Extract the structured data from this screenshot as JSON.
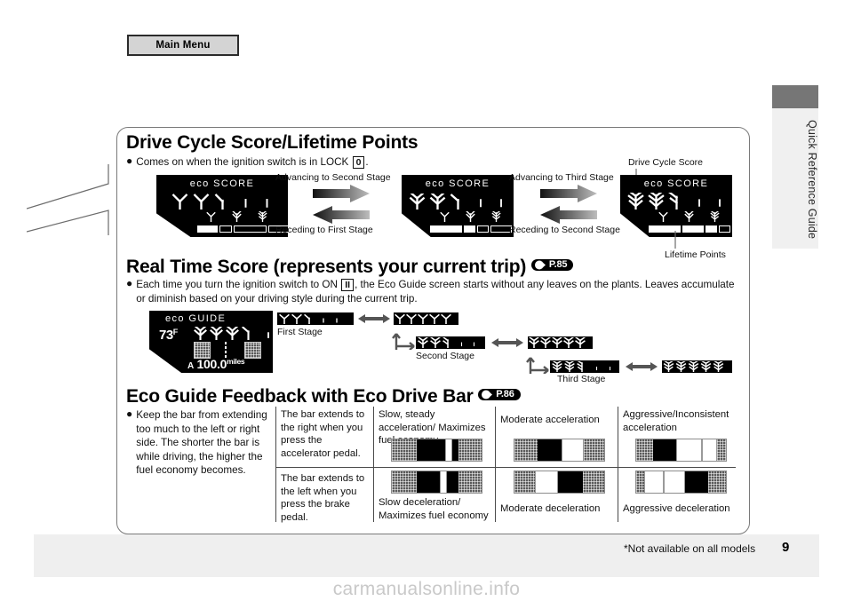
{
  "header": {
    "main_menu_label": "Main Menu"
  },
  "side_tab": {
    "label": "Quick Reference Guide"
  },
  "sections": [
    {
      "title": "Drive Cycle Score/Lifetime Points",
      "bullet": "Comes on when the ignition switch is in LOCK",
      "key": "0",
      "bullet_tail": ".",
      "callouts": {
        "advancing_second": "Advancing to Second Stage",
        "receding_first": "Receding to First Stage",
        "advancing_third": "Advancing to Third Stage",
        "receding_second": "Receding to Second Stage",
        "drive_cycle_score": "Drive Cycle Score",
        "lifetime_points": "Lifetime Points"
      },
      "displays": [
        {
          "title": "eco SCORE"
        },
        {
          "title": "eco SCORE"
        },
        {
          "title": "eco SCORE"
        }
      ]
    },
    {
      "title": "Real Time Score (represents your current trip)",
      "page_ref": "P.85",
      "bullet_part1": "Each time you turn the ignition switch to ON",
      "key": "II",
      "bullet_part2": ", the Eco Guide screen starts without any leaves on the plants. Leaves accumulate",
      "bullet_line2": "or diminish based on your driving style during the current trip.",
      "display": {
        "title": "eco GUIDE",
        "temperature": "73",
        "temp_unit": "F",
        "trip_letter": "A",
        "odometer": "100.0",
        "odometer_unit": "miles"
      },
      "stages": {
        "first": "First Stage",
        "second": "Second Stage",
        "third": "Third Stage"
      }
    },
    {
      "title": "Eco Guide Feedback with Eco Drive Bar",
      "page_ref": "P.86",
      "bullet": "Keep the bar from extending too much to the left or right side. The shorter the bar is while driving, the higher the fuel economy becomes.",
      "table": {
        "row_desc_accel": "The bar extends to the right when you press the accelerator pedal.",
        "row_desc_decel": "The bar extends to the left when you press the brake pedal.",
        "col_headers": [
          "Slow, steady acceleration/ Maximizes fuel economy",
          "Moderate acceleration",
          "Aggressive/Inconsistent acceleration"
        ],
        "row2_labels": [
          "Slow deceleration/ Maximizes fuel economy",
          "Moderate deceleration",
          "Aggressive deceleration"
        ]
      }
    }
  ],
  "footer": {
    "note": "*Not available on all models",
    "page_number": "9"
  },
  "watermark": "carmanualsonline.info",
  "colors": {
    "page_bg": "#ffffff",
    "footer_band": "#efefef",
    "side_tab": "#f0f0f0",
    "side_tab_cap": "#767676",
    "button_face": "#d4d4d4",
    "display_black": "#000000",
    "box_border": "#7a7a7a"
  }
}
